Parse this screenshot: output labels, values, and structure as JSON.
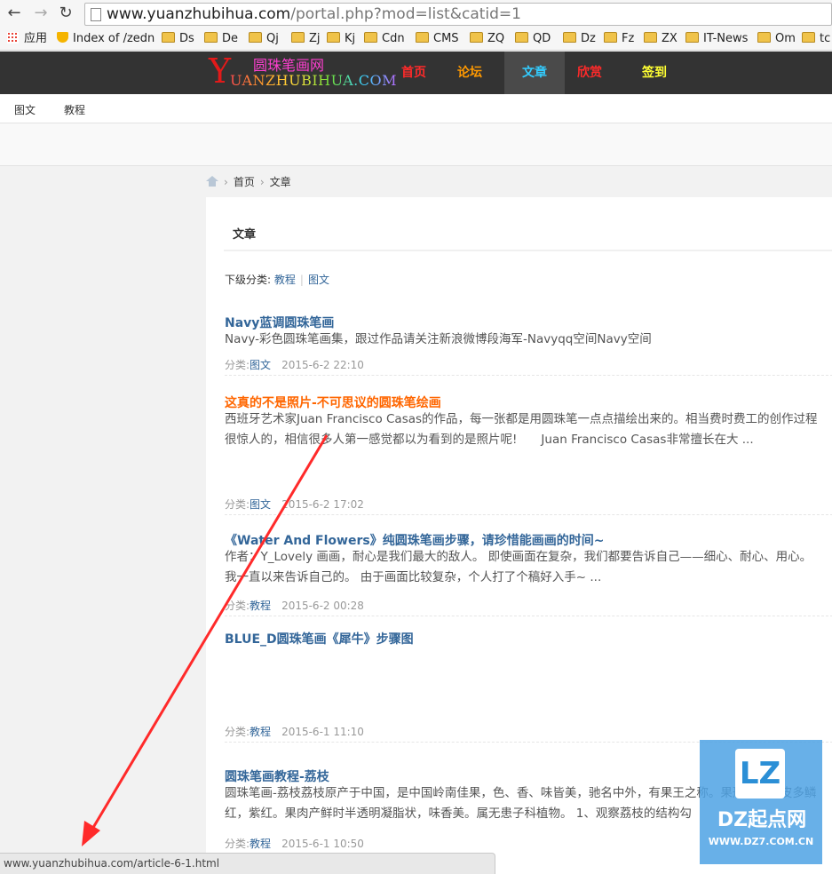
{
  "browser": {
    "url_host": "www.yuanzhubihua.com",
    "url_path": "/portal.php?mod=list&catid=1",
    "bookmarks": [
      "应用",
      "Index of /zedn",
      "Ds",
      "De",
      "Qj",
      "Zj",
      "Kj",
      "Cdn",
      "CMS",
      "ZQ",
      "QD",
      "Dz",
      "Fz",
      "ZX",
      "IT-News",
      "Om",
      "tc"
    ],
    "status_url": "www.yuanzhubihua.com/article-6-1.html"
  },
  "site": {
    "logo_y": "Y",
    "logo_cn": "圆珠笔画网",
    "logo_en": "UANZHUBIHUA.COM",
    "nav": [
      {
        "label": "首页",
        "color": "#ff2a2a"
      },
      {
        "label": "论坛",
        "color": "#ff9900"
      },
      {
        "label": "文章",
        "color": "#33ccff"
      },
      {
        "label": "欣赏",
        "color": "#ff2a2a"
      },
      {
        "label": "签到",
        "color": "#ffff33"
      }
    ],
    "active_nav": "文章",
    "subnav": [
      "图文",
      "教程"
    ]
  },
  "breadcrumb": [
    "首页",
    "文章"
  ],
  "panel": {
    "title": "文章",
    "subcats_label": "下级分类:",
    "subcats": [
      "教程",
      "图文"
    ]
  },
  "articles": [
    {
      "title": "Navy蓝调圆珠笔画",
      "hot": false,
      "summary": [
        "Navy-彩色圆珠笔画集，跟过作品请关注新浪微博段海军-Navyqq空间Navy空间"
      ],
      "category": "图文",
      "time": "2015-6-2 22:10"
    },
    {
      "title": "这真的不是照片-不可思议的圆珠笔绘画",
      "hot": true,
      "summary": [
        "西班牙艺术家Juan Francisco Casas的作品，每一张都是用圆珠笔一点点描绘出来的。相当费时费工的创作过程",
        "很惊人的，相信很多人第一感觉都以为看到的是照片呢!　　Juan Francisco Casas非常擅长在大 ..."
      ],
      "category": "图文",
      "time": "2015-6-2 17:02"
    },
    {
      "title": "《Water And Flowers》纯圆珠笔画步骤，请珍惜能画画的时间~",
      "hot": false,
      "summary": [
        "作者：Y_Lovely 画画，耐心是我们最大的敌人。 即使画面在复杂，我们都要告诉自己——细心、耐心、用心。",
        "我一直以来告诉自己的。 由于画面比较复杂，个人打了个稿好入手~ ..."
      ],
      "category": "教程",
      "time": "2015-6-2 00:28"
    },
    {
      "title": "BLUE_D圆珠笔画《犀牛》步骤图",
      "hot": false,
      "summary": [],
      "category": "教程",
      "time": "2015-6-1 11:10"
    },
    {
      "title": "圆珠笔画教程-荔枝",
      "hot": false,
      "summary": [
        "圆珠笔画-荔枝荔枝原产于中国，是中国岭南佳果，色、香、味皆美，驰名中外，有果王之称。果形为，果皮多鳞",
        "红，紫红。果肉产鲜时半透明凝脂状，味香美。属无患子科植物。 1、观察荔枝的结构勾"
      ],
      "category": "教程",
      "time": "2015-6-1 10:50"
    }
  ],
  "meta_label": "分类:",
  "watermark": {
    "letters": "LZ",
    "cn": "DZ起点网",
    "url": "WWW.DZ7.COM.CN"
  },
  "colors": {
    "header_bg": "#333333",
    "link": "#336699",
    "hot": "#ff6600",
    "arrow": "#ff2a2a"
  }
}
